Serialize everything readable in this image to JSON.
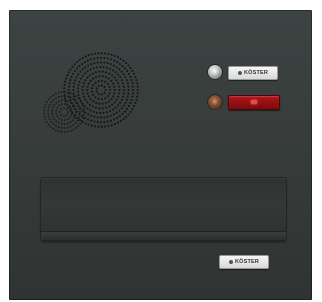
{
  "device": {
    "brand_label_top": "KÖSTER",
    "brand_label_bottom": "KÖSTER",
    "components": {
      "speaker": "speaker-grille-icon",
      "bell_button_1": "chrome-push-button",
      "bell_button_2": "copper-push-button",
      "name_plate_1": "name-plate",
      "name_plate_2": "illuminated-red-plate",
      "mail_slot": "letter-slot"
    },
    "colors": {
      "panel": "#3a3f3e",
      "red_plate": "#a01216",
      "nameplate": "#e8e8e8"
    }
  }
}
